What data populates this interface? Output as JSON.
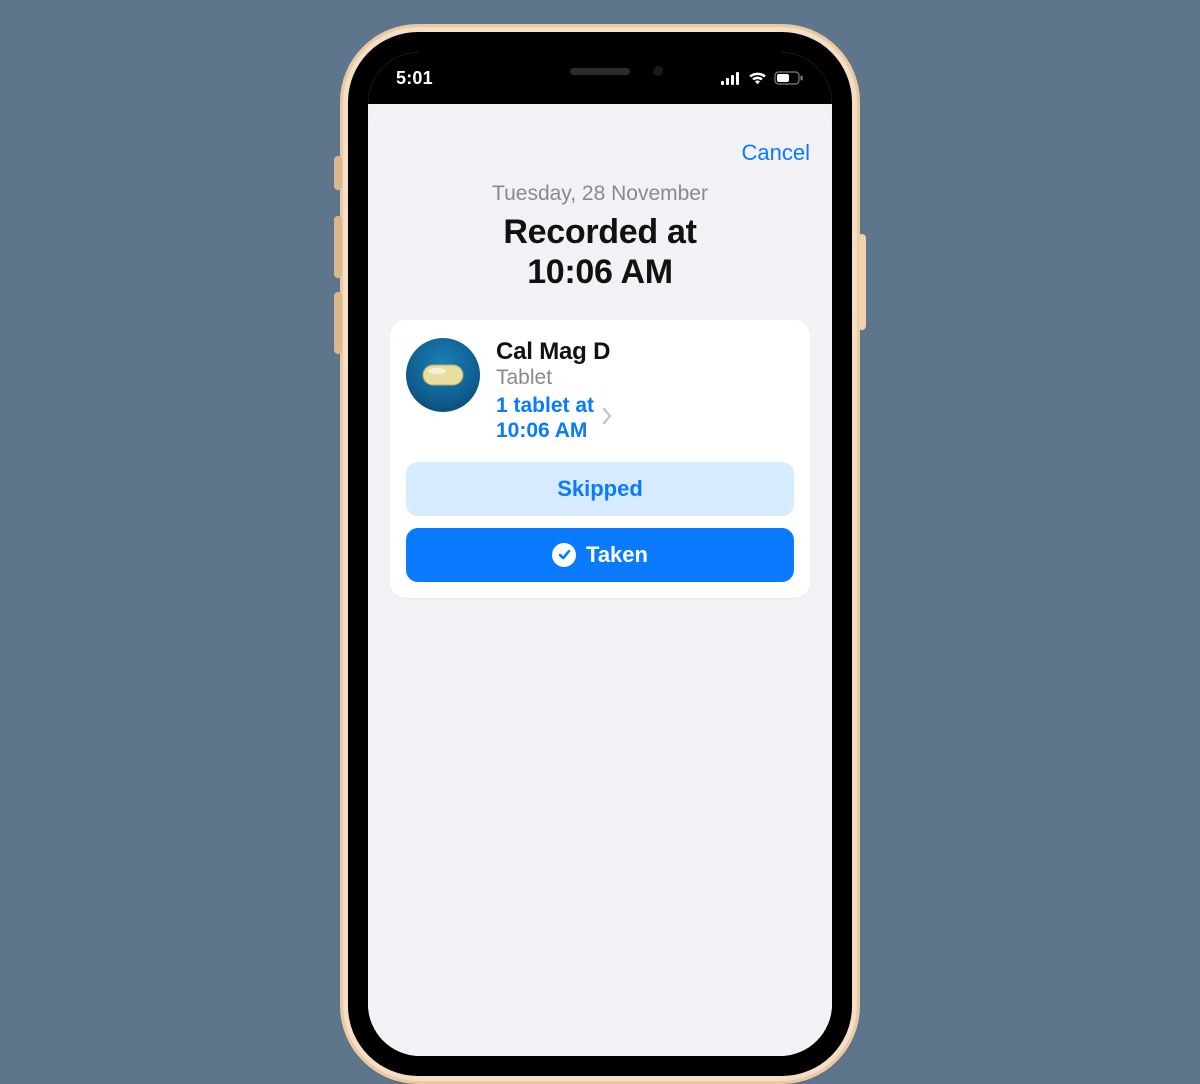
{
  "status": {
    "time": "5:01"
  },
  "sheet": {
    "cancel": "Cancel",
    "date": "Tuesday, 28 November",
    "title_line1": "Recorded at",
    "title_line2": "10:06 AM"
  },
  "medication": {
    "name": "Cal Mag D",
    "form": "Tablet",
    "dose_line1": "1 tablet at",
    "dose_line2": "10:06 AM"
  },
  "actions": {
    "skipped": "Skipped",
    "taken": "Taken"
  }
}
